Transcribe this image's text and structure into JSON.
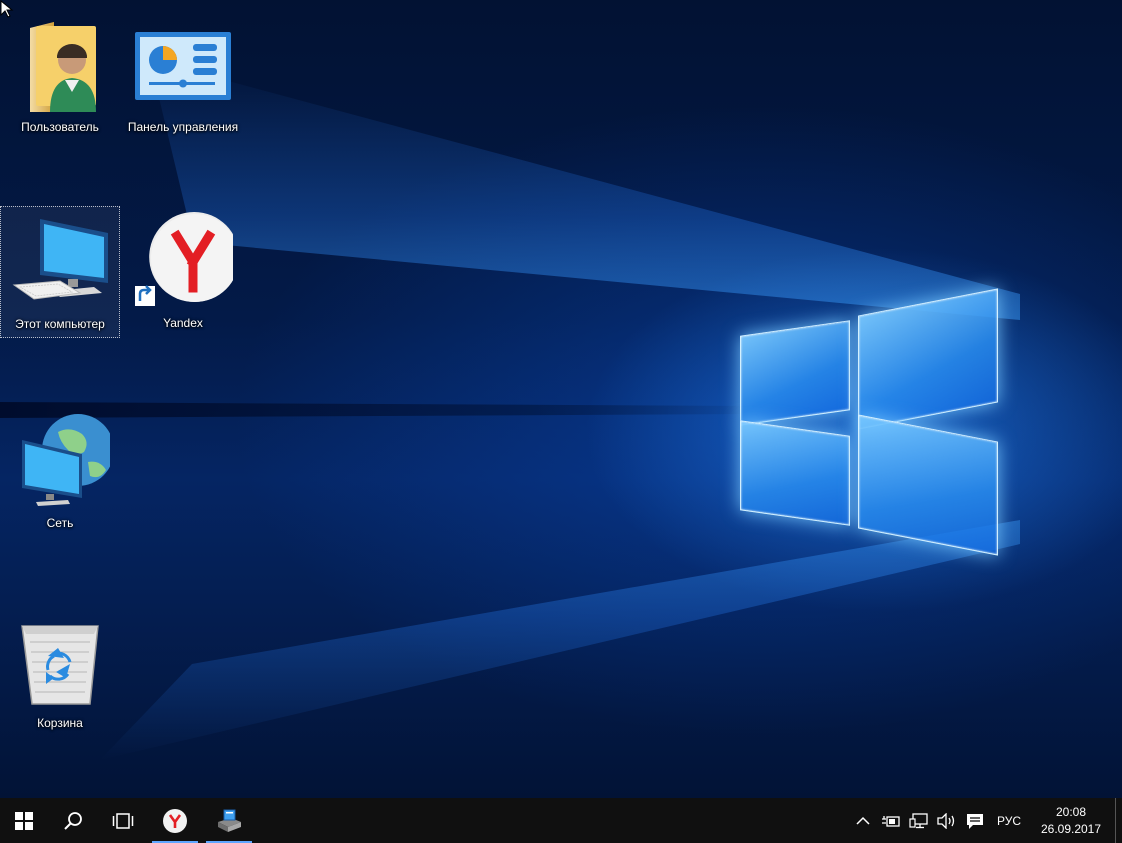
{
  "desktop": {
    "icons": [
      {
        "label": "Пользователь",
        "icon": "user-folder-icon"
      },
      {
        "label": "Панель управления",
        "icon": "control-panel-icon"
      },
      {
        "label": "Этот компьютер",
        "icon": "computer-icon"
      },
      {
        "label": "Yandex",
        "icon": "yandex-browser-icon"
      },
      {
        "label": "Сеть",
        "icon": "network-icon"
      },
      {
        "label": "Корзина",
        "icon": "recycle-bin-icon"
      }
    ],
    "selected_icon": "Этот компьютер"
  },
  "taskbar": {
    "buttons": [
      {
        "name": "start",
        "icon": "windows-start-icon"
      },
      {
        "name": "search",
        "icon": "search-icon"
      },
      {
        "name": "task-view",
        "icon": "task-view-icon"
      },
      {
        "name": "yandex",
        "icon": "yandex-browser-icon",
        "active": true
      },
      {
        "name": "app",
        "icon": "installer-app-icon",
        "active": true
      }
    ],
    "tray": {
      "icons": [
        "chevron-up-icon",
        "power-battery-icon",
        "network-wired-icon",
        "volume-icon",
        "notification-icon"
      ],
      "language": "РУС",
      "time": "20:08",
      "date": "26.09.2017"
    }
  },
  "colors": {
    "taskbar": "#101010",
    "accent": "#5ea6ff",
    "yandex_red": "#e31e24"
  }
}
